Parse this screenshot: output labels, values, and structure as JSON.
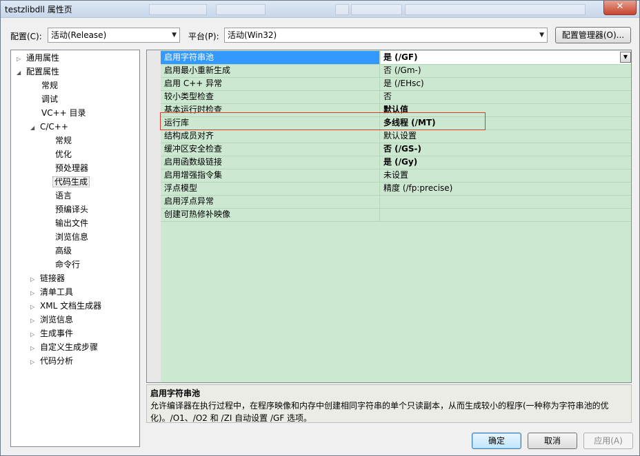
{
  "window": {
    "title": "testzlibdll 属性页",
    "close_glyph": "✕"
  },
  "config": {
    "config_label": "配置(C):",
    "config_value": "活动(Release)",
    "platform_label": "平台(P):",
    "platform_value": "活动(Win32)",
    "manager_button": "配置管理器(O)..."
  },
  "tree": {
    "items": [
      {
        "label": "通用属性",
        "expander": "▷"
      },
      {
        "label": "配置属性",
        "expander": "◢"
      },
      {
        "label": "常规",
        "expander": ""
      },
      {
        "label": "调试",
        "expander": ""
      },
      {
        "label": "VC++ 目录",
        "expander": ""
      },
      {
        "label": "C/C++",
        "expander": "◢"
      },
      {
        "label": "常规",
        "expander": ""
      },
      {
        "label": "优化",
        "expander": ""
      },
      {
        "label": "预处理器",
        "expander": ""
      },
      {
        "label": "代码生成",
        "expander": ""
      },
      {
        "label": "语言",
        "expander": ""
      },
      {
        "label": "预编译头",
        "expander": ""
      },
      {
        "label": "输出文件",
        "expander": ""
      },
      {
        "label": "浏览信息",
        "expander": ""
      },
      {
        "label": "高级",
        "expander": ""
      },
      {
        "label": "命令行",
        "expander": ""
      },
      {
        "label": "链接器",
        "expander": "▷"
      },
      {
        "label": "清单工具",
        "expander": "▷"
      },
      {
        "label": "XML 文档生成器",
        "expander": "▷"
      },
      {
        "label": "浏览信息",
        "expander": "▷"
      },
      {
        "label": "生成事件",
        "expander": "▷"
      },
      {
        "label": "自定义生成步骤",
        "expander": "▷"
      },
      {
        "label": "代码分析",
        "expander": "▷"
      }
    ]
  },
  "properties": [
    {
      "name": "启用字符串池",
      "value": "是 (/GF)"
    },
    {
      "name": "启用最小重新生成",
      "value": "否 (/Gm-)"
    },
    {
      "name": "启用 C++ 异常",
      "value": "是 (/EHsc)"
    },
    {
      "name": "较小类型检查",
      "value": "否"
    },
    {
      "name": "基本运行时检查",
      "value": "默认值"
    },
    {
      "name": "运行库",
      "value": "多线程 (/MT)"
    },
    {
      "name": "结构成员对齐",
      "value": "默认设置"
    },
    {
      "name": "缓冲区安全检查",
      "value": "否 (/GS-)"
    },
    {
      "name": "启用函数级链接",
      "value": "是 (/Gy)"
    },
    {
      "name": "启用增强指令集",
      "value": "未设置"
    },
    {
      "name": "浮点模型",
      "value": "精度 (/fp:precise)"
    },
    {
      "name": "启用浮点异常",
      "value": ""
    },
    {
      "name": "创建可热修补映像",
      "value": ""
    }
  ],
  "description": {
    "title": "启用字符串池",
    "text": "允许编译器在执行过程中，在程序映像和内存中创建相同字符串的单个只读副本，从而生成较小的程序(一种称为字符串池的优化)。/O1、/O2 和 /ZI 自动设置 /GF 选项。"
  },
  "buttons": {
    "ok": "确定",
    "cancel": "取消",
    "apply": "应用(A)"
  },
  "icons": {
    "dropdown_arrow": "▼"
  }
}
